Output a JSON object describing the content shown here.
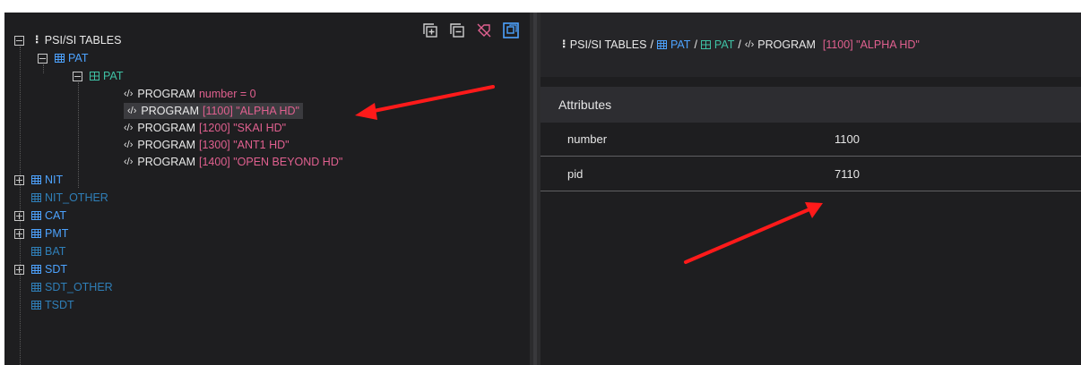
{
  "colors": {
    "pane_bg": "#1e1e20",
    "label_blue": "#4da3ff",
    "label_green": "#3fc1a5",
    "value_pink": "#e0608f",
    "arrow_red": "#ff1a1a"
  },
  "toolbar": {
    "buttons": [
      {
        "name": "expand-all-icon"
      },
      {
        "name": "collapse-all-icon"
      },
      {
        "name": "clear-highlight-icon"
      },
      {
        "name": "toggle-sync-icon"
      }
    ]
  },
  "tree": {
    "root": {
      "icon": "tree-root-icon",
      "label": "PSI/SI TABLES"
    },
    "pat": {
      "label": "PAT"
    },
    "pat_section": {
      "label": "PAT"
    },
    "programs": [
      {
        "label": "PROGRAM",
        "value": "number = 0"
      },
      {
        "label": "PROGRAM",
        "value": "[1100] \"ALPHA HD\""
      },
      {
        "label": "PROGRAM",
        "value": "[1200] \"SKAI HD\""
      },
      {
        "label": "PROGRAM",
        "value": "[1300] \"ANT1 HD\""
      },
      {
        "label": "PROGRAM",
        "value": "[1400] \"OPEN BEYOND HD\""
      }
    ],
    "nit": {
      "label": "NIT"
    },
    "nit_other": {
      "label": "NIT_OTHER"
    },
    "cat": {
      "label": "CAT"
    },
    "pmt": {
      "label": "PMT"
    },
    "bat": {
      "label": "BAT"
    },
    "sdt": {
      "label": "SDT"
    },
    "sdt_other": {
      "label": "SDT_OTHER"
    },
    "tsdt": {
      "label": "TSDT"
    }
  },
  "breadcrumb": {
    "root": "PSI/SI TABLES",
    "sep": "/",
    "pat": "PAT",
    "pat_section": "PAT",
    "program": "PROGRAM",
    "program_value": "[1100] \"ALPHA HD\""
  },
  "attributes": {
    "heading": "Attributes",
    "rows": [
      {
        "key": "number",
        "value": "1100"
      },
      {
        "key": "pid",
        "value": "7110"
      }
    ]
  }
}
